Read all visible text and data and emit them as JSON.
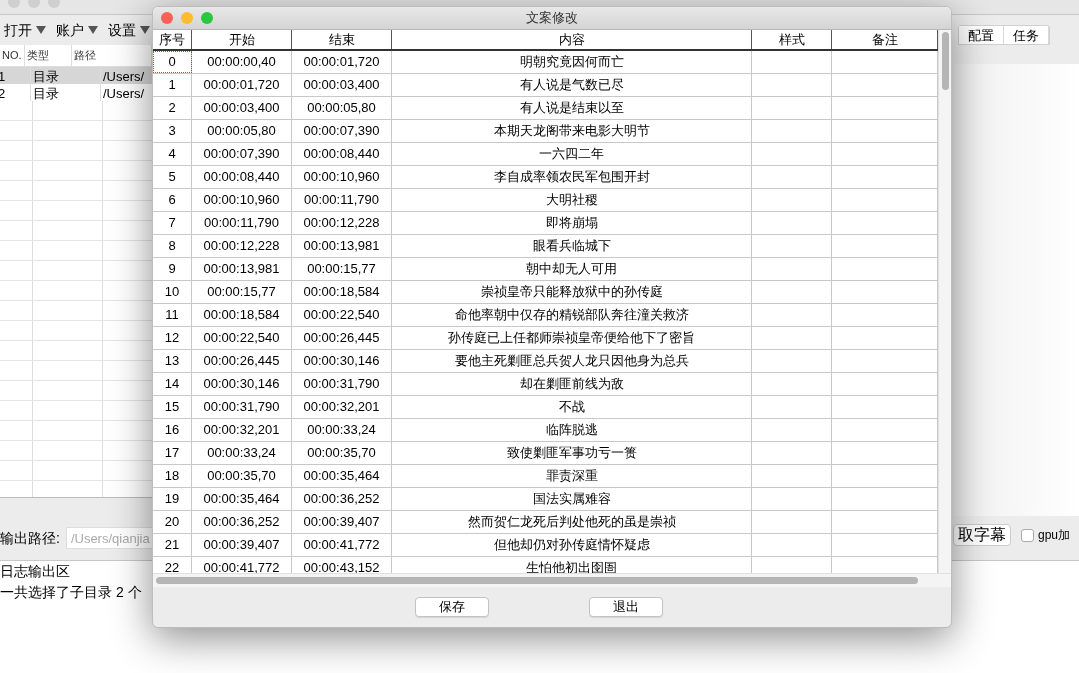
{
  "menus": [
    "打开",
    "账户",
    "设置"
  ],
  "file_table": {
    "columns": [
      "NO.",
      "类型",
      "路径"
    ],
    "rows": [
      {
        "no": "1",
        "type": "目录",
        "path": "/Users/",
        "selected": true
      },
      {
        "no": "2",
        "type": "目录",
        "path": "/Users/",
        "selected": false
      }
    ]
  },
  "side_tabs": [
    {
      "label": "配置",
      "selected": false
    },
    {
      "label": "任务",
      "selected": false
    }
  ],
  "output_path": {
    "label": "输出路径:",
    "placeholder": "/Users/qianjia"
  },
  "extract_button": "取字幕",
  "gpu_checkbox": {
    "label": "gpu加",
    "checked": false
  },
  "log": {
    "title": "日志输出区",
    "lines": [
      "一共选择了子目录 2 个"
    ]
  },
  "dialog": {
    "title": "文案修改",
    "columns": [
      "序号",
      "开始",
      "结束",
      "内容",
      "样式",
      "备注"
    ],
    "rows": [
      {
        "cells": [
          "0",
          "00:00:00,40",
          "00:00:01,720",
          "明朝究竟因何而亡"
        ],
        "focused": true
      },
      {
        "cells": [
          "1",
          "00:00:01,720",
          "00:00:03,400",
          "有人说是气数已尽"
        ],
        "focused": false
      },
      {
        "cells": [
          "2",
          "00:00:03,400",
          "00:00:05,80",
          "有人说是结束以至"
        ],
        "focused": false
      },
      {
        "cells": [
          "3",
          "00:00:05,80",
          "00:00:07,390",
          "本期天龙阁带来电影大明节"
        ],
        "focused": false
      },
      {
        "cells": [
          "4",
          "00:00:07,390",
          "00:00:08,440",
          "一六四二年"
        ],
        "focused": false
      },
      {
        "cells": [
          "5",
          "00:00:08,440",
          "00:00:10,960",
          "李自成率领农民军包围开封"
        ],
        "focused": false
      },
      {
        "cells": [
          "6",
          "00:00:10,960",
          "00:00:11,790",
          "大明社稷"
        ],
        "focused": false
      },
      {
        "cells": [
          "7",
          "00:00:11,790",
          "00:00:12,228",
          "即将崩塌"
        ],
        "focused": false
      },
      {
        "cells": [
          "8",
          "00:00:12,228",
          "00:00:13,981",
          "眼看兵临城下"
        ],
        "focused": false
      },
      {
        "cells": [
          "9",
          "00:00:13,981",
          "00:00:15,77",
          "朝中却无人可用"
        ],
        "focused": false
      },
      {
        "cells": [
          "10",
          "00:00:15,77",
          "00:00:18,584",
          "崇祯皇帝只能释放狱中的孙传庭"
        ],
        "focused": false
      },
      {
        "cells": [
          "11",
          "00:00:18,584",
          "00:00:22,540",
          "命他率朝中仅存的精锐部队奔往潼关救济"
        ],
        "focused": false
      },
      {
        "cells": [
          "12",
          "00:00:22,540",
          "00:00:26,445",
          "孙传庭已上任都师崇祯皇帝便给他下了密旨"
        ],
        "focused": false
      },
      {
        "cells": [
          "13",
          "00:00:26,445",
          "00:00:30,146",
          "要他主死剿匪总兵贺人龙只因他身为总兵"
        ],
        "focused": false
      },
      {
        "cells": [
          "14",
          "00:00:30,146",
          "00:00:31,790",
          "却在剿匪前线为敌"
        ],
        "focused": false
      },
      {
        "cells": [
          "15",
          "00:00:31,790",
          "00:00:32,201",
          "不战"
        ],
        "focused": false
      },
      {
        "cells": [
          "16",
          "00:00:32,201",
          "00:00:33,24",
          "临阵脱逃"
        ],
        "focused": false
      },
      {
        "cells": [
          "17",
          "00:00:33,24",
          "00:00:35,70",
          "致使剿匪军事功亏一篑"
        ],
        "focused": false
      },
      {
        "cells": [
          "18",
          "00:00:35,70",
          "00:00:35,464",
          "罪责深重"
        ],
        "focused": false
      },
      {
        "cells": [
          "19",
          "00:00:35,464",
          "00:00:36,252",
          "国法实属难容"
        ],
        "focused": false
      },
      {
        "cells": [
          "20",
          "00:00:36,252",
          "00:00:39,407",
          "然而贺仁龙死后判处他死的虽是崇祯"
        ],
        "focused": false
      },
      {
        "cells": [
          "21",
          "00:00:39,407",
          "00:00:41,772",
          "但他却仍对孙传庭情怀疑虑"
        ],
        "focused": false
      },
      {
        "cells": [
          "22",
          "00:00:41,772",
          "00:00:43,152",
          "生怕他初出囹圄"
        ],
        "focused": false
      }
    ],
    "buttons": [
      "保存",
      "退出"
    ]
  }
}
